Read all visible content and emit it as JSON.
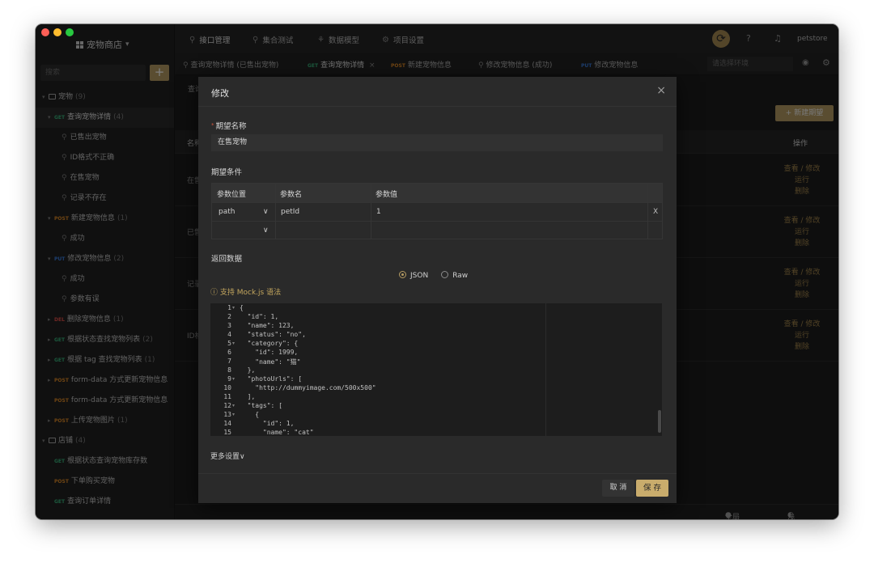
{
  "project": {
    "name": "宠物商店",
    "caret": "▾"
  },
  "sidebar": {
    "search_placeholder": "搜索",
    "add_label": "+",
    "tree": [
      {
        "type": "folder",
        "label": "宠物",
        "count": "(9)",
        "level": 0
      },
      {
        "type": "api",
        "method": "GET",
        "label": "查询宠物详情",
        "count": "(4)",
        "level": 1,
        "selected": true
      },
      {
        "type": "case",
        "label": "已售出宠物",
        "level": 2
      },
      {
        "type": "case",
        "label": "ID格式不正确",
        "level": 2
      },
      {
        "type": "case",
        "label": "在售宠物",
        "level": 2
      },
      {
        "type": "case",
        "label": "记录不存在",
        "level": 2
      },
      {
        "type": "api",
        "method": "POST",
        "label": "新建宠物信息",
        "count": "(1)",
        "level": 1
      },
      {
        "type": "case",
        "label": "成功",
        "level": 2
      },
      {
        "type": "api",
        "method": "PUT",
        "label": "修改宠物信息",
        "count": "(2)",
        "level": 1
      },
      {
        "type": "case",
        "label": "成功",
        "level": 2
      },
      {
        "type": "case",
        "label": "参数有误",
        "level": 2
      },
      {
        "type": "api",
        "method": "DEL",
        "label": "删除宠物信息",
        "count": "(1)",
        "level": 1
      },
      {
        "type": "api",
        "method": "GET",
        "label": "根据状态查找宠物列表",
        "count": "(2)",
        "level": 1
      },
      {
        "type": "api",
        "method": "GET",
        "label": "根据 tag 查找宠物列表",
        "count": "(1)",
        "level": 1
      },
      {
        "type": "api",
        "method": "POST",
        "label": "form-data 方式更新宠物信息",
        "count": "",
        "level": 1
      },
      {
        "type": "api",
        "method": "POST",
        "label": "form-data 方式更新宠物信息",
        "count": "",
        "level": 1,
        "nocaret": true
      },
      {
        "type": "api",
        "method": "POST",
        "label": "上传宠物图片",
        "count": "(1)",
        "level": 1
      },
      {
        "type": "folder",
        "label": "店铺",
        "count": "(4)",
        "level": 0
      },
      {
        "type": "api",
        "method": "GET",
        "label": "根据状态查询宠物库存数",
        "count": "",
        "level": 1,
        "nocaret": true
      },
      {
        "type": "api",
        "method": "POST",
        "label": "下单购买宠物",
        "count": "",
        "level": 1,
        "nocaret": true
      },
      {
        "type": "api",
        "method": "GET",
        "label": "查询订单详情",
        "count": "",
        "level": 1,
        "nocaret": true
      }
    ]
  },
  "topnav": {
    "items": [
      {
        "label": "接口管理",
        "icon": "link-icon"
      },
      {
        "label": "集合测试",
        "icon": "test-icon"
      },
      {
        "label": "数据模型",
        "icon": "model-icon"
      },
      {
        "label": "项目设置",
        "icon": "gear-icon"
      }
    ],
    "user": "petstore"
  },
  "tabs": [
    {
      "method": "",
      "label": "查询宠物详情 (已售出宠物)"
    },
    {
      "method": "GET",
      "label": "查询宠物详情",
      "close": "×"
    },
    {
      "method": "POST",
      "label": "新建宠物信息"
    },
    {
      "method": "",
      "label": "修改宠物信息 (成功)"
    },
    {
      "method": "PUT",
      "label": "修改宠物信息"
    }
  ],
  "env_placeholder": "请选择环境",
  "main": {
    "crumb": "查询",
    "new_button": "+ 新建期望",
    "header_name": "名称",
    "header_ops": "操作",
    "rows": [
      {
        "name": "在售",
        "actions": [
          "查看 / 修改",
          "运行",
          "删除"
        ]
      },
      {
        "name": "已售",
        "actions": [
          "查看 / 修改",
          "运行",
          "删除"
        ]
      },
      {
        "name": "记录",
        "actions": [
          "查看 / 修改",
          "运行",
          "删除"
        ]
      },
      {
        "name": "ID格",
        "actions": [
          "查看 / 修改",
          "运行",
          "删除"
        ]
      }
    ]
  },
  "statusbar": {
    "cookie": "全局 Cookie",
    "theme": "浅金 - 暗"
  },
  "modal": {
    "title": "修改",
    "close": "×",
    "name_label": "期望名称",
    "name_value": "在售宠物",
    "conditions_label": "期望条件",
    "cond_headers": [
      "参数位置",
      "参数名",
      "参数值"
    ],
    "cond_rows": [
      {
        "position": "path",
        "name": "petId",
        "value": "1",
        "remove": "X"
      },
      {
        "position": "",
        "name": "",
        "value": "",
        "remove": ""
      }
    ],
    "return_label": "返回数据",
    "formats": [
      {
        "label": "JSON",
        "selected": true
      },
      {
        "label": "Raw",
        "selected": false
      }
    ],
    "mock_link": "支持 Mock.js 语法",
    "code_lines": [
      "{",
      "  \"id\": 1,",
      "  \"name\": 123,",
      "  \"status\": \"no\",",
      "  \"category\": {",
      "    \"id\": 1999,",
      "    \"name\": \"猫\"",
      "  },",
      "  \"photoUrls\": [",
      "    \"http://dummyimage.com/500x500\"",
      "  ],",
      "  \"tags\": [",
      "    {",
      "      \"id\": 1,",
      "      \"name\": \"cat\""
    ],
    "fold_lines": [
      1,
      5,
      9,
      12,
      13
    ],
    "more_settings": "更多设置",
    "cancel": "取 消",
    "save": "保 存"
  }
}
